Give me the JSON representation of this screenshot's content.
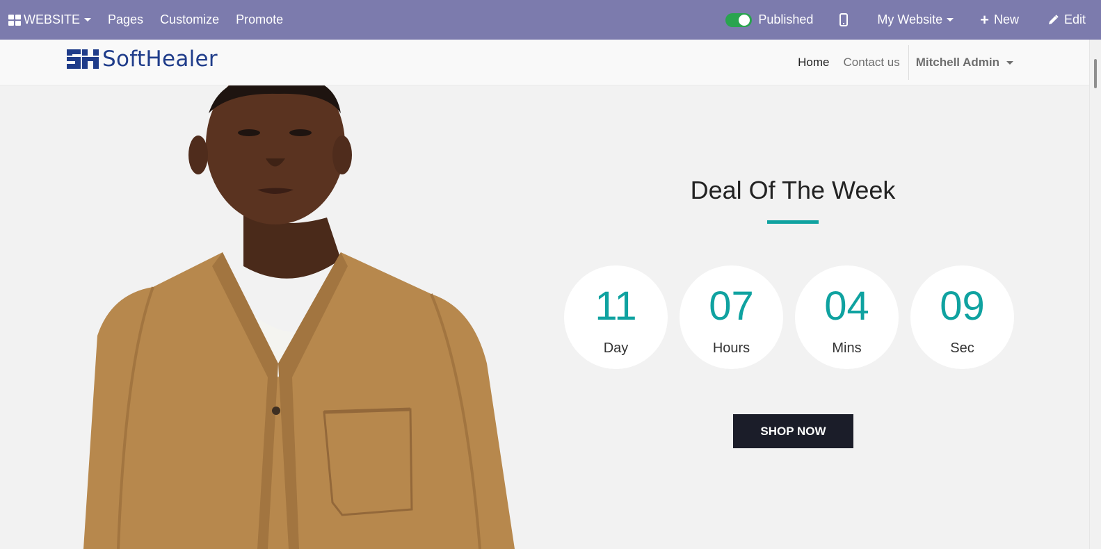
{
  "admin_bar": {
    "website_menu": "WEBSITE",
    "pages": "Pages",
    "customize": "Customize",
    "promote": "Promote",
    "published": "Published",
    "my_website": "My Website",
    "new": "New",
    "edit": "Edit",
    "color": "#7c7bad"
  },
  "site_header": {
    "logo_text": "SoftHealer",
    "nav": {
      "home": "Home",
      "contact": "Contact us",
      "user": "Mitchell Admin"
    }
  },
  "deal": {
    "title": "Deal Of The Week",
    "accent_color": "#0fa2a0",
    "counters": [
      {
        "value": "11",
        "label": "Day"
      },
      {
        "value": "07",
        "label": "Hours"
      },
      {
        "value": "04",
        "label": "Mins"
      },
      {
        "value": "09",
        "label": "Sec"
      }
    ],
    "button": "SHOP NOW"
  }
}
